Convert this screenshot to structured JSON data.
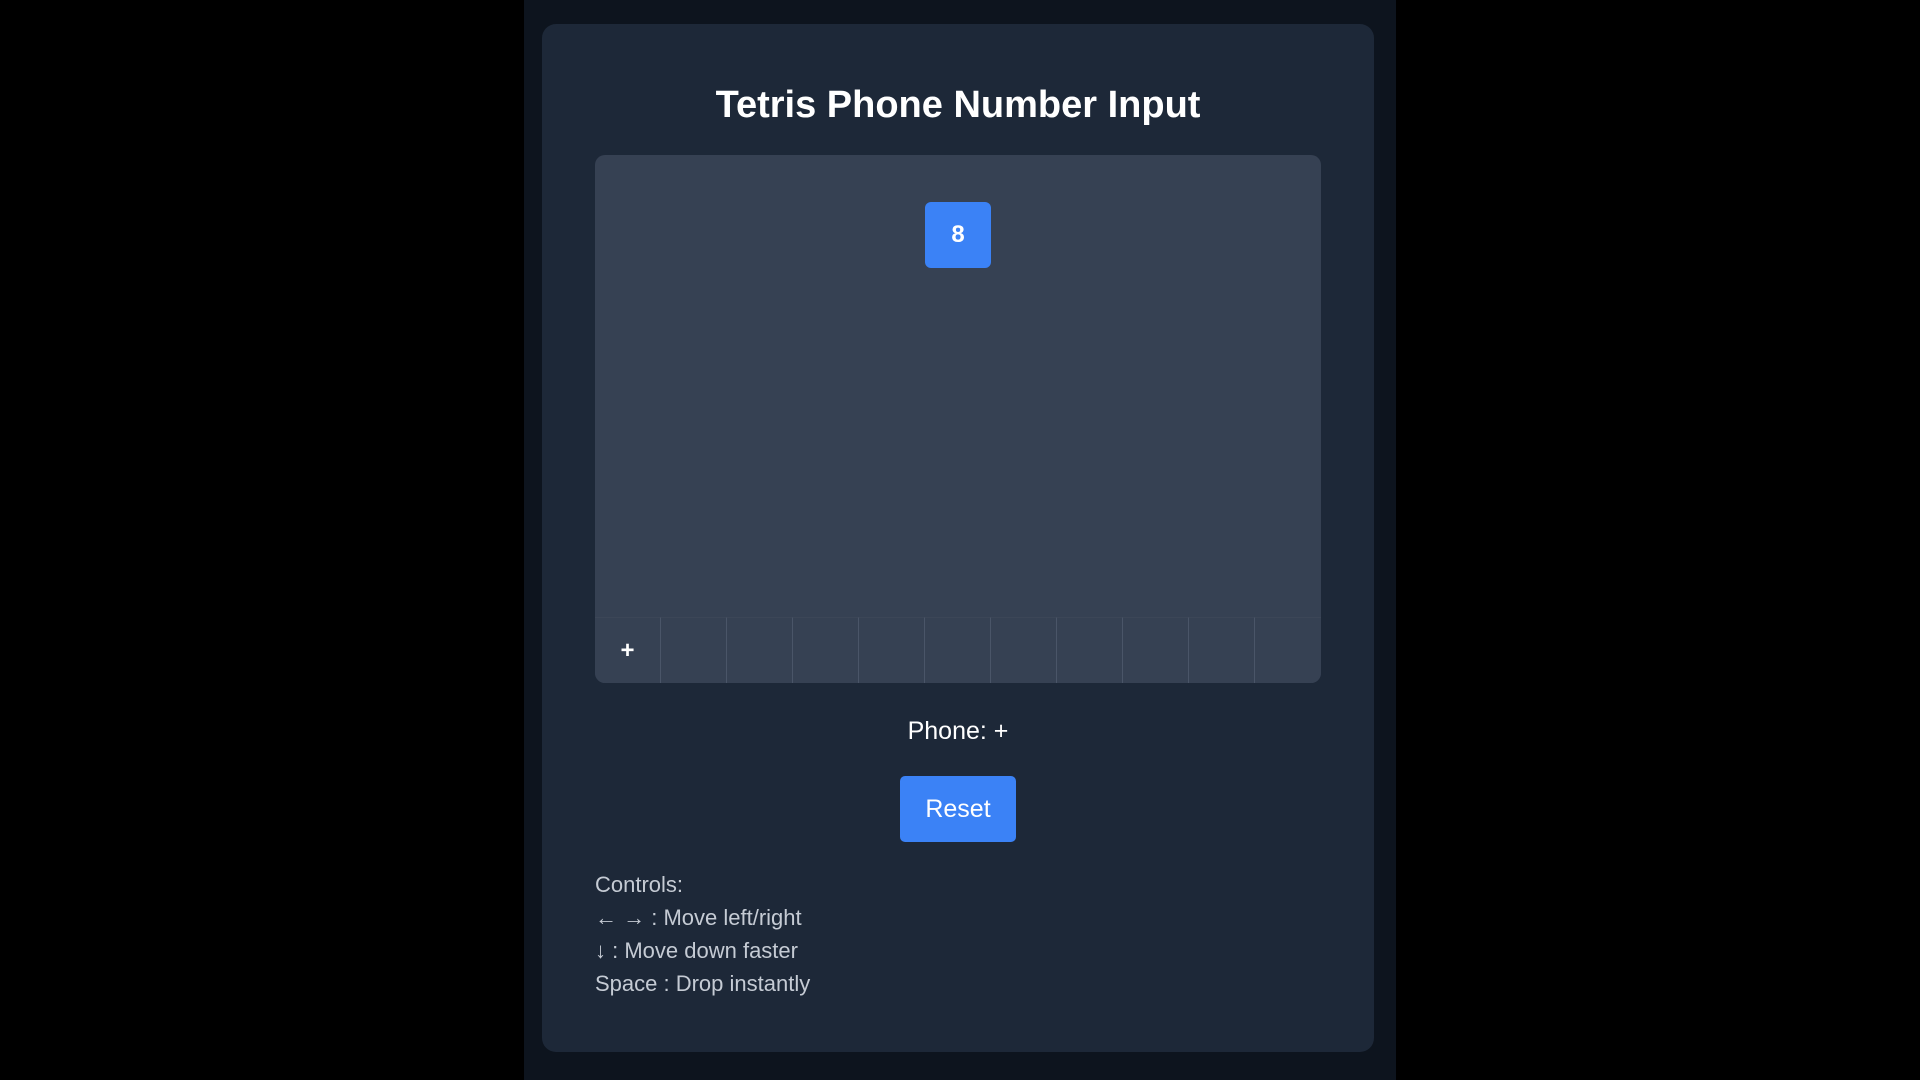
{
  "app": {
    "title": "Tetris Phone Number Input"
  },
  "board": {
    "falling_digit": "8",
    "slots": [
      "+",
      "",
      "",
      "",
      "",
      "",
      "",
      "",
      "",
      "",
      ""
    ]
  },
  "phone": {
    "label": "Phone:",
    "value": "+"
  },
  "reset_label": "Reset",
  "controls": {
    "heading": "Controls:",
    "lines": [
      "← → : Move left/right",
      "↓ : Move down faster",
      "Space : Drop instantly"
    ]
  },
  "colors": {
    "accent": "#3b82f6",
    "card_background": "#1d2838",
    "board_background": "#364153"
  }
}
